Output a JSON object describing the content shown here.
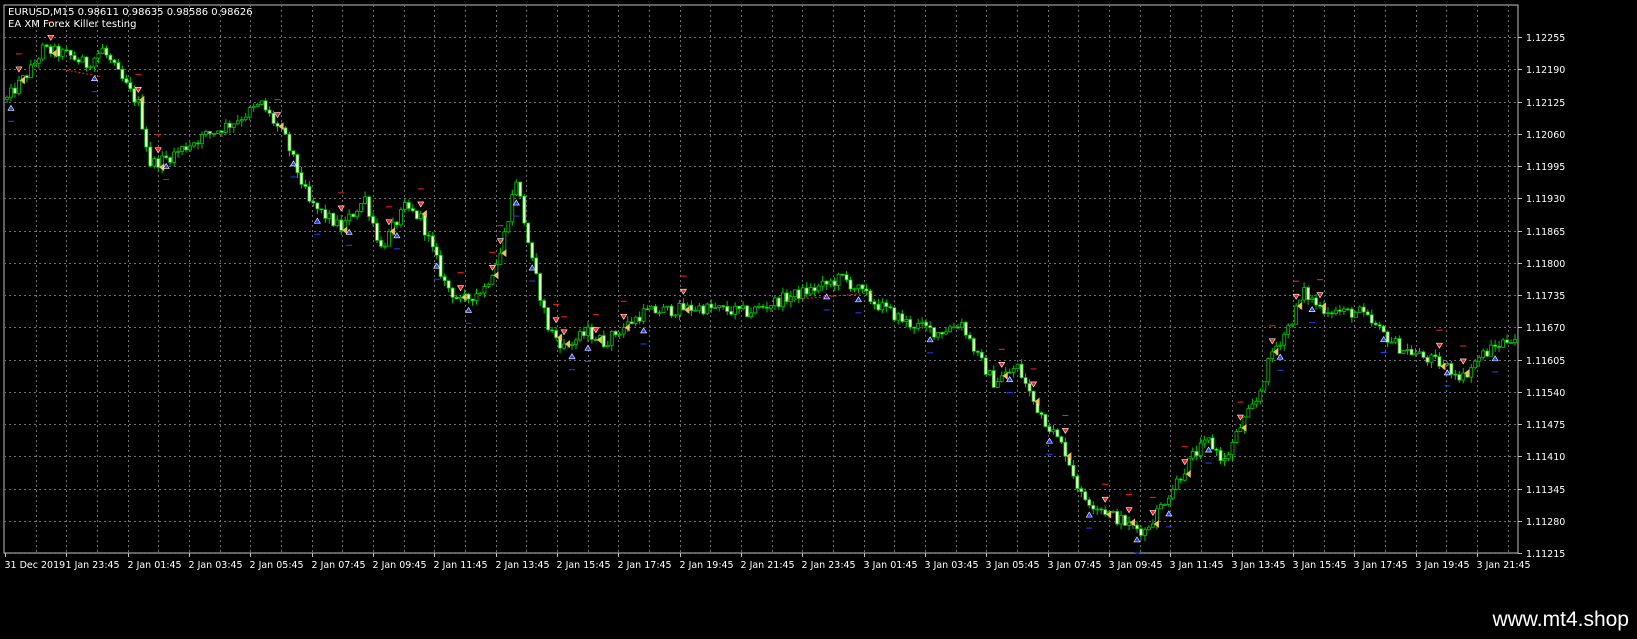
{
  "header": {
    "symbol_line": "EURUSD,M15  0.98611 0.98635 0.98586 0.98626",
    "indicator_name": "EA XM Forex Killer testing"
  },
  "watermark": "www.mt4.shop",
  "colors": {
    "background": "#000000",
    "grid": "#707070",
    "bull_candle": "#00c800",
    "bear_candle": "#f0ffd0",
    "axis_text": "#ffffff",
    "sell_arrow": "#ff2020",
    "buy_arrow": "#2040ff",
    "close_marker": "#f0c060"
  },
  "chart_data": {
    "type": "candlestick",
    "symbol": "EURUSD",
    "timeframe": "M15",
    "ylim": [
      1.11215,
      1.1232
    ],
    "y_ticks": [
      "1.12255",
      "1.12190",
      "1.12125",
      "1.12060",
      "1.11995",
      "1.11930",
      "1.11865",
      "1.11800",
      "1.11735",
      "1.11670",
      "1.11605",
      "1.11540",
      "1.11475",
      "1.11410",
      "1.11345",
      "1.11280",
      "1.11215"
    ],
    "x_ticks": [
      "31 Dec 2019",
      "1 Jan 23:45",
      "2 Jan 01:45",
      "2 Jan 03:45",
      "2 Jan 05:45",
      "2 Jan 07:45",
      "2 Jan 09:45",
      "2 Jan 11:45",
      "2 Jan 13:45",
      "2 Jan 15:45",
      "2 Jan 17:45",
      "2 Jan 19:45",
      "2 Jan 21:45",
      "2 Jan 23:45",
      "3 Jan 01:45",
      "3 Jan 03:45",
      "3 Jan 05:45",
      "3 Jan 07:45",
      "3 Jan 09:45",
      "3 Jan 11:45",
      "3 Jan 13:45",
      "3 Jan 15:45",
      "3 Jan 17:45",
      "3 Jan 19:45",
      "3 Jan 21:45"
    ],
    "price_path": [
      [
        0,
        1.1213
      ],
      [
        6,
        1.1219
      ],
      [
        9,
        1.1223
      ],
      [
        15,
        1.1222
      ],
      [
        20,
        1.122
      ],
      [
        24,
        1.1223
      ],
      [
        28,
        1.1218
      ],
      [
        33,
        1.1212
      ],
      [
        36,
        1.12
      ],
      [
        40,
        1.1201
      ],
      [
        48,
        1.1205
      ],
      [
        56,
        1.1208
      ],
      [
        64,
        1.1212
      ],
      [
        70,
        1.1205
      ],
      [
        76,
        1.1192
      ],
      [
        84,
        1.1187
      ],
      [
        90,
        1.1193
      ],
      [
        94,
        1.1183
      ],
      [
        100,
        1.1191
      ],
      [
        104,
        1.1189
      ],
      [
        110,
        1.1176
      ],
      [
        114,
        1.1172
      ],
      [
        120,
        1.1175
      ],
      [
        124,
        1.1182
      ],
      [
        128,
        1.1197
      ],
      [
        132,
        1.118
      ],
      [
        136,
        1.1167
      ],
      [
        140,
        1.1163
      ],
      [
        146,
        1.1166
      ],
      [
        150,
        1.1164
      ],
      [
        160,
        1.117
      ],
      [
        174,
        1.1171
      ],
      [
        186,
        1.117
      ],
      [
        196,
        1.1173
      ],
      [
        204,
        1.1175
      ],
      [
        210,
        1.1177
      ],
      [
        218,
        1.1172
      ],
      [
        226,
        1.1168
      ],
      [
        234,
        1.1166
      ],
      [
        240,
        1.1168
      ],
      [
        244,
        1.1161
      ],
      [
        248,
        1.1156
      ],
      [
        254,
        1.1159
      ],
      [
        258,
        1.1152
      ],
      [
        262,
        1.1147
      ],
      [
        266,
        1.1142
      ],
      [
        270,
        1.1133
      ],
      [
        276,
        1.113
      ],
      [
        282,
        1.1127
      ],
      [
        286,
        1.1126
      ],
      [
        290,
        1.1131
      ],
      [
        294,
        1.1136
      ],
      [
        298,
        1.1141
      ],
      [
        302,
        1.1144
      ],
      [
        306,
        1.114
      ],
      [
        310,
        1.1147
      ],
      [
        314,
        1.1152
      ],
      [
        318,
        1.1162
      ],
      [
        322,
        1.1167
      ],
      [
        326,
        1.1174
      ],
      [
        330,
        1.1171
      ],
      [
        336,
        1.117
      ],
      [
        340,
        1.117
      ],
      [
        344,
        1.1167
      ],
      [
        350,
        1.1163
      ],
      [
        356,
        1.1161
      ],
      [
        362,
        1.1159
      ],
      [
        366,
        1.1157
      ],
      [
        370,
        1.1161
      ],
      [
        374,
        1.1163
      ],
      [
        378,
        1.1165
      ]
    ],
    "sell_signal_indices": [
      3,
      11,
      33,
      38,
      68,
      84,
      96,
      104,
      114,
      122,
      124,
      138,
      140,
      148,
      155,
      170,
      250,
      258,
      266,
      276,
      282,
      288,
      296,
      310,
      318,
      324,
      330,
      360,
      366
    ],
    "buy_signal_indices": [
      1,
      22,
      40,
      72,
      78,
      86,
      98,
      108,
      116,
      128,
      132,
      142,
      146,
      160,
      206,
      214,
      232,
      252,
      262,
      272,
      284,
      292,
      302,
      320,
      328,
      346,
      362,
      374
    ],
    "series_count": 380
  }
}
